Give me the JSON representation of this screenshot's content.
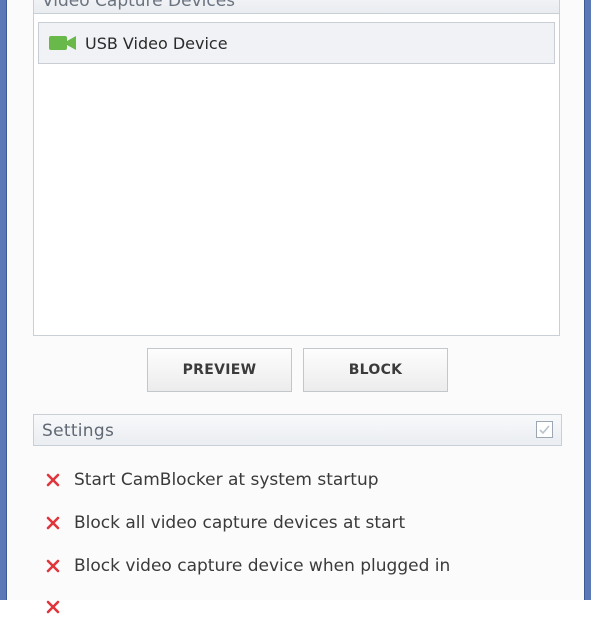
{
  "devices": {
    "header": "Video Capture Devices",
    "items": [
      {
        "label": "USB Video Device",
        "icon": "camera-icon"
      }
    ]
  },
  "buttons": {
    "preview": "PREVIEW",
    "block": "BLOCK"
  },
  "settings": {
    "title": "Settings",
    "options": [
      {
        "label": "Start CamBlocker at system startup",
        "state": "off"
      },
      {
        "label": "Block all video capture devices at start",
        "state": "off"
      },
      {
        "label": "Block video capture device when plugged in",
        "state": "off"
      },
      {
        "label": "",
        "state": "off"
      }
    ]
  },
  "colors": {
    "frame": "#5a79b6",
    "camera_icon": "#69b84a",
    "option_off": "#e0353b"
  }
}
